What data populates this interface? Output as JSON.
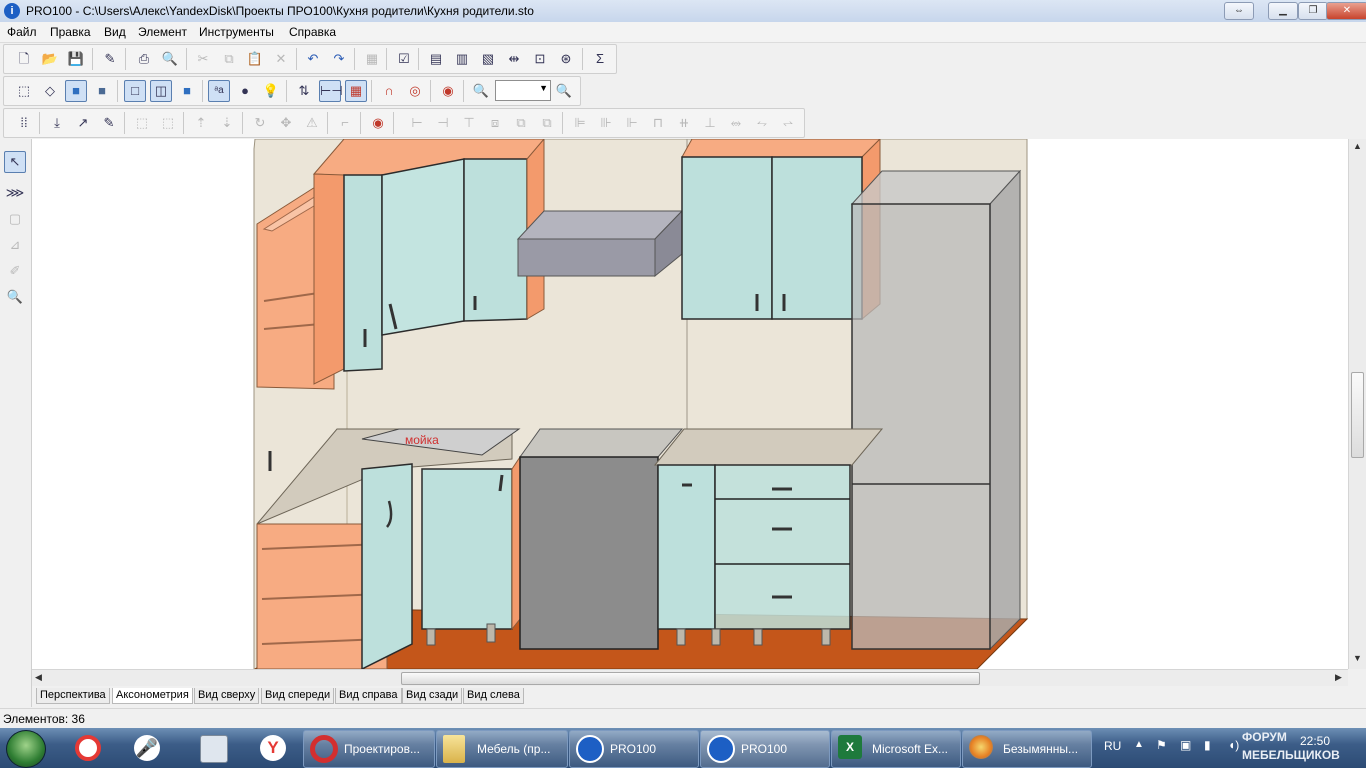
{
  "window": {
    "title": "PRO100 - C:\\Users\\Алекс\\YandexDisk\\Проекты ПРО100\\Кухня родители\\Кухня родители.sto",
    "app_icon_letter": "i"
  },
  "menu": [
    "Файл",
    "Правка",
    "Вид",
    "Элемент",
    "Инструменты",
    "Справка"
  ],
  "toolbar": {
    "zoom_value": ""
  },
  "canvas": {
    "label_sink": "мойка"
  },
  "view_tabs": [
    "Перспектива",
    "Аксонометрия",
    "Вид сверху",
    "Вид спереди",
    "Вид справа",
    "Вид сзади",
    "Вид слева"
  ],
  "active_view_tab": "Аксонометрия",
  "status": {
    "elements": "Элементов: 36"
  },
  "taskbar": {
    "tasks": [
      {
        "label": "Проектиров...",
        "icon": "opera-icon"
      },
      {
        "label": "Мебель (пр...",
        "icon": "folder-icon"
      },
      {
        "label": "PRO100",
        "icon": "pro100-icon"
      },
      {
        "label": "PRO100",
        "icon": "pro100-icon"
      },
      {
        "label": "Microsoft Ex...",
        "icon": "excel-icon"
      },
      {
        "label": "Безымянны...",
        "icon": "paint-icon"
      }
    ],
    "language": "RU",
    "clock_time": "22:50",
    "watermark_line1": "ФОРУМ",
    "watermark_line2": "МЕБЕЛЬЩИКОВ"
  },
  "colors": {
    "wall": "#ebe5d8",
    "floor": "#c4561a",
    "orange_panel": "#f7ab82",
    "glass_door": "#bde0dc",
    "grey_unit": "#8c8c8c",
    "sink_label": "#d03030",
    "taskbar": "#3c5d88"
  }
}
